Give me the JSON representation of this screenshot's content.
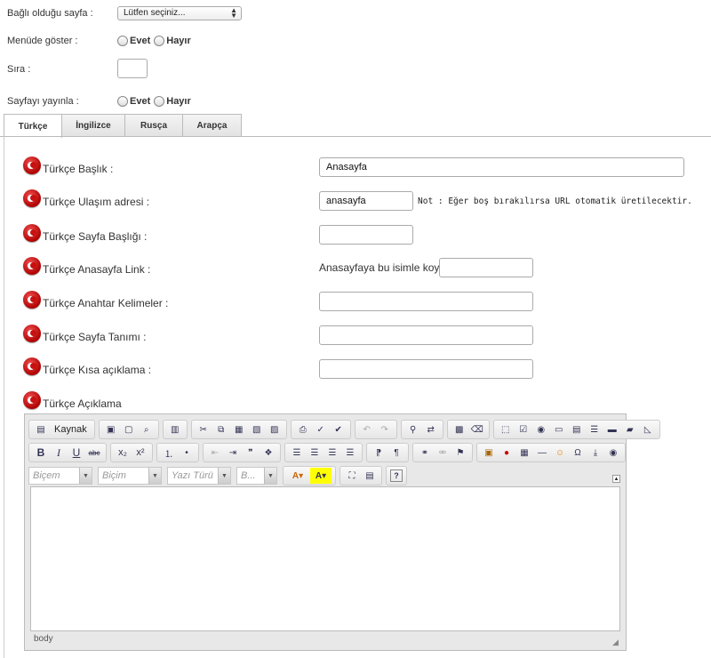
{
  "settings": {
    "parent_page_label": "Bağlı olduğu sayfa :",
    "parent_page_value": "Lütfen seçiniz...",
    "show_in_menu_label": "Menüde göster :",
    "order_label": "Sıra :",
    "publish_label": "Sayfayı yayınla :",
    "yes_label": "Evet",
    "no_label": "Hayır"
  },
  "tabs": [
    {
      "label": "Türkçe"
    },
    {
      "label": "İngilizce"
    },
    {
      "label": "Rusça"
    },
    {
      "label": "Arapça"
    }
  ],
  "form": {
    "title_label": "Türkçe Başlık :",
    "title_value": "Anasayfa",
    "url_label": "Türkçe Ulaşım adresi :",
    "url_value": "anasayfa",
    "url_note": "Not : Eğer boş bırakılırsa URL otomatik üretilecektir.",
    "page_title_label": "Türkçe Sayfa Başlığı :",
    "home_link_label": "Türkçe Anasayfa Link :",
    "home_link_inline_label": "Anasayfaya bu isimle koy:",
    "keywords_label": "Türkçe Anahtar Kelimeler :",
    "description_label": "Türkçe Sayfa Tanımı :",
    "short_desc_label": "Türkçe Kısa açıklama :",
    "content_label": "Türkçe Açıklama"
  },
  "editor": {
    "source_label": "Kaynak",
    "style_placeholder": "Biçem",
    "format_placeholder": "Biçim",
    "font_placeholder": "Yazı Türü",
    "size_placeholder": "B...",
    "status_path": "body"
  }
}
